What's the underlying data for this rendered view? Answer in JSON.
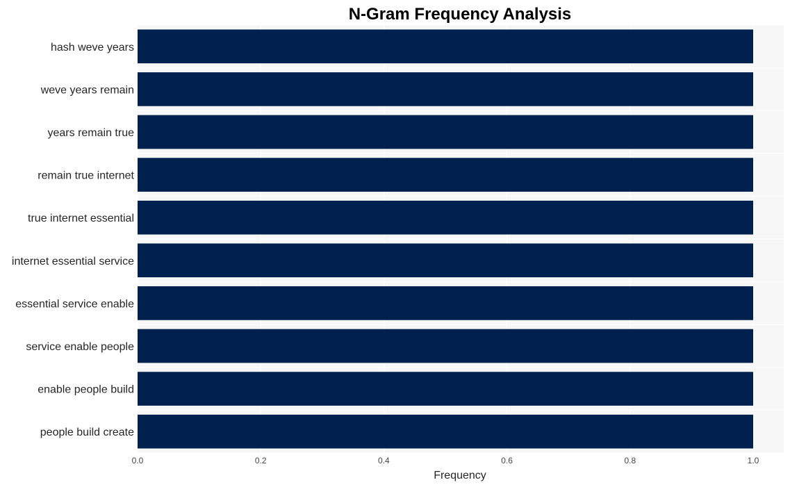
{
  "chart_data": {
    "type": "bar",
    "orientation": "horizontal",
    "title": "N-Gram Frequency Analysis",
    "xlabel": "Frequency",
    "ylabel": "",
    "categories": [
      "hash weve years",
      "weve years remain",
      "years remain true",
      "remain true internet",
      "true internet essential",
      "internet essential service",
      "essential service enable",
      "service enable people",
      "enable people build",
      "people build create"
    ],
    "values": [
      1,
      1,
      1,
      1,
      1,
      1,
      1,
      1,
      1,
      1
    ],
    "xlim": [
      0,
      1.05
    ],
    "xticks": [
      "0.0",
      "0.2",
      "0.4",
      "0.6",
      "0.8",
      "1.0"
    ],
    "grid": true,
    "legend": "none",
    "colors": {
      "bar": "#00214e",
      "plot_background": "#f7f7f7",
      "grid": "#ffffff"
    }
  }
}
